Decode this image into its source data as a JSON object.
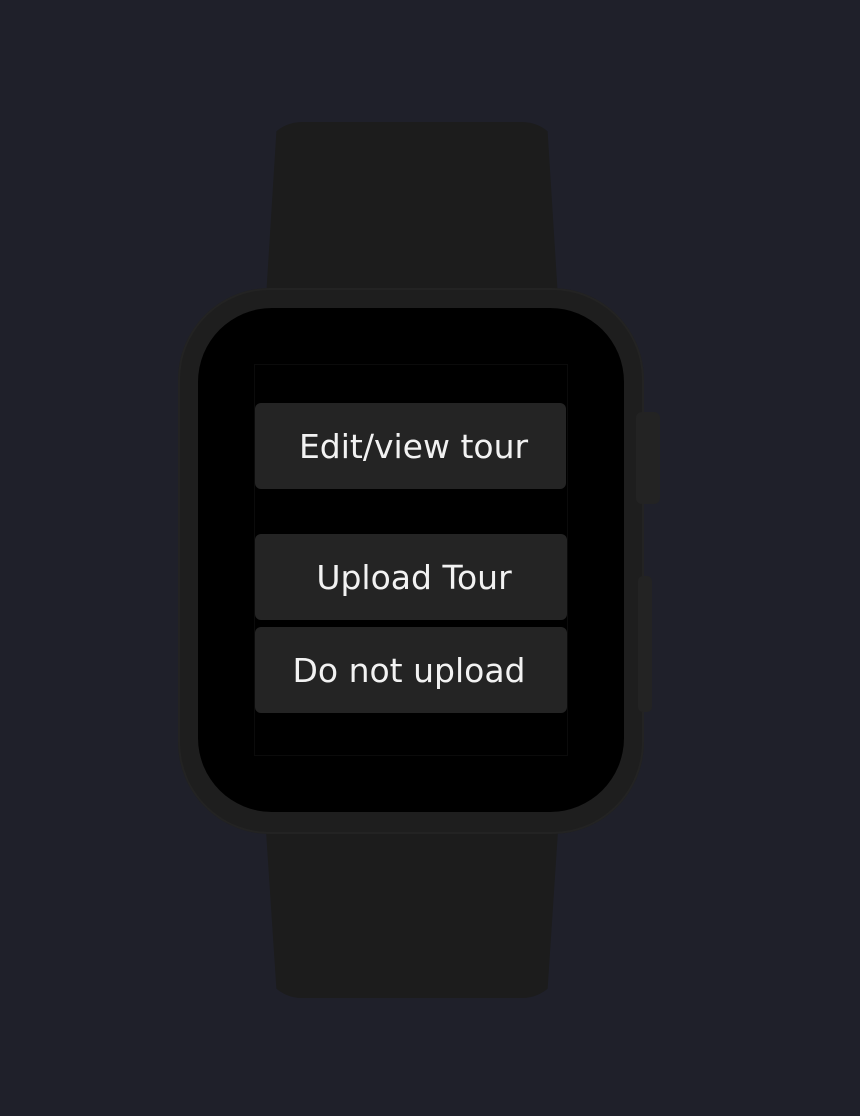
{
  "buttons": {
    "edit_view_tour": "Edit/view tour",
    "upload_tour": "Upload Tour",
    "do_not_upload": "Do not upload"
  },
  "colors": {
    "background": "#1f202a",
    "device": "#1e1e1e",
    "screen": "#000000",
    "button": "#242424",
    "button_text": "#f2f2f2"
  }
}
